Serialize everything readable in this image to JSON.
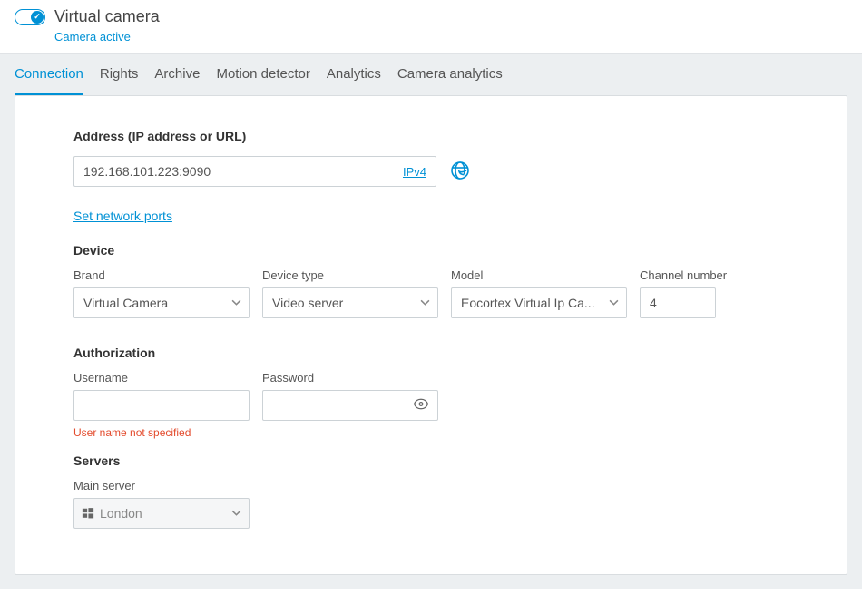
{
  "header": {
    "title": "Virtual camera",
    "subtitle": "Camera active",
    "toggle_on": true
  },
  "tabs": [
    {
      "label": "Connection",
      "active": true
    },
    {
      "label": "Rights"
    },
    {
      "label": "Archive"
    },
    {
      "label": "Motion detector"
    },
    {
      "label": "Analytics"
    },
    {
      "label": "Camera analytics"
    }
  ],
  "address": {
    "label": "Address (IP address or URL)",
    "value": "192.168.101.223:9090",
    "mode": "IPv4",
    "network_ports_link": "Set network ports"
  },
  "device": {
    "section": "Device",
    "brand_label": "Brand",
    "brand_value": "Virtual Camera",
    "type_label": "Device type",
    "type_value": "Video server",
    "model_label": "Model",
    "model_value": "Eocortex Virtual Ip Ca...",
    "channel_label": "Channel number",
    "channel_value": "4"
  },
  "auth": {
    "section": "Authorization",
    "username_label": "Username",
    "username_value": "",
    "password_label": "Password",
    "password_value": "",
    "error": "User name not specified"
  },
  "servers": {
    "section": "Servers",
    "main_label": "Main server",
    "main_value": "London"
  }
}
